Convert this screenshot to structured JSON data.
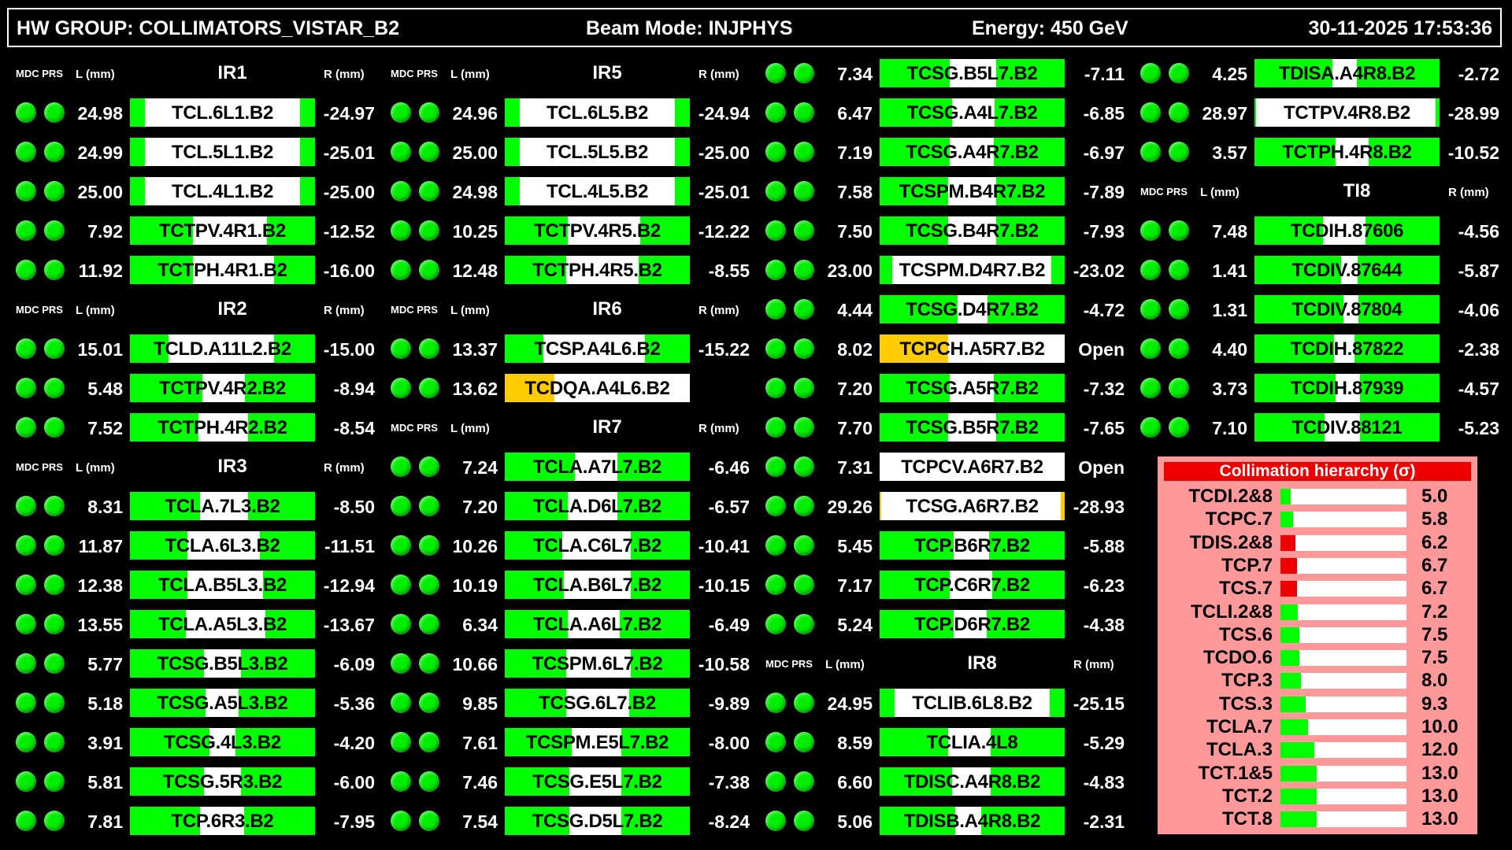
{
  "header": {
    "hw_group": "HW GROUP: COLLIMATORS_VISTAR_B2",
    "beam_mode": "Beam Mode: INJPHYS",
    "energy": "Energy: 450 GeV",
    "datetime": "30-11-2025 17:53:36"
  },
  "labels": {
    "mdc_prs": "MDC PRS",
    "l_mm": "L (mm)",
    "r_mm": "R (mm)"
  },
  "colors": {
    "green": "#00ff00",
    "orange": "#ffcc00",
    "white": "#ffffff",
    "led": "#00ee00",
    "red": "#ee0000",
    "pink": "#ff9999"
  },
  "columns": [
    [
      {
        "type": "header",
        "ir": "IR1"
      },
      {
        "type": "row",
        "l": "24.98",
        "name": "TCL.6L1.B2",
        "r": "-24.97",
        "left": 0.08,
        "right": 0.92,
        "color": "green"
      },
      {
        "type": "row",
        "l": "24.99",
        "name": "TCL.5L1.B2",
        "r": "-25.01",
        "left": 0.08,
        "right": 0.92,
        "color": "green"
      },
      {
        "type": "row",
        "l": "25.00",
        "name": "TCL.4L1.B2",
        "r": "-25.00",
        "left": 0.08,
        "right": 0.92,
        "color": "green"
      },
      {
        "type": "row",
        "l": "7.92",
        "name": "TCTPV.4R1.B2",
        "r": "-12.52",
        "left": 0.34,
        "right": 0.74,
        "color": "green"
      },
      {
        "type": "row",
        "l": "11.92",
        "name": "TCTPH.4R1.B2",
        "r": "-16.00",
        "left": 0.34,
        "right": 0.78,
        "color": "green"
      },
      {
        "type": "header",
        "ir": "IR2"
      },
      {
        "type": "row",
        "l": "15.01",
        "name": "TCLD.A11L2.B2",
        "r": "-15.00",
        "left": 0.21,
        "right": 0.78,
        "color": "green"
      },
      {
        "type": "row",
        "l": "5.48",
        "name": "TCTPV.4R2.B2",
        "r": "-8.94",
        "left": 0.39,
        "right": 0.62,
        "color": "green"
      },
      {
        "type": "row",
        "l": "7.52",
        "name": "TCTPH.4R2.B2",
        "r": "-8.54",
        "left": 0.37,
        "right": 0.64,
        "color": "green"
      },
      {
        "type": "header",
        "ir": "IR3"
      },
      {
        "type": "row",
        "l": "8.31",
        "name": "TCLA.7L3.B2",
        "r": "-8.50",
        "left": 0.38,
        "right": 0.64,
        "color": "green"
      },
      {
        "type": "row",
        "l": "11.87",
        "name": "TCLA.6L3.B2",
        "r": "-11.51",
        "left": 0.31,
        "right": 0.7,
        "color": "green"
      },
      {
        "type": "row",
        "l": "12.38",
        "name": "TCLA.B5L3.B2",
        "r": "-12.94",
        "left": 0.31,
        "right": 0.72,
        "color": "green"
      },
      {
        "type": "row",
        "l": "13.55",
        "name": "TCLA.A5L3.B2",
        "r": "-13.67",
        "left": 0.3,
        "right": 0.73,
        "color": "green"
      },
      {
        "type": "row",
        "l": "5.77",
        "name": "TCSG.B5L3.B2",
        "r": "-6.09",
        "left": 0.4,
        "right": 0.6,
        "color": "green"
      },
      {
        "type": "row",
        "l": "5.18",
        "name": "TCSG.A5L3.B2",
        "r": "-5.36",
        "left": 0.41,
        "right": 0.59,
        "color": "green"
      },
      {
        "type": "row",
        "l": "3.91",
        "name": "TCSG.4L3.B2",
        "r": "-4.20",
        "left": 0.43,
        "right": 0.57,
        "color": "green"
      },
      {
        "type": "row",
        "l": "5.81",
        "name": "TCSG.5R3.B2",
        "r": "-6.00",
        "left": 0.4,
        "right": 0.6,
        "color": "green"
      },
      {
        "type": "row",
        "l": "7.81",
        "name": "TCP.6R3.B2",
        "r": "-7.95",
        "left": 0.38,
        "right": 0.62,
        "color": "green"
      }
    ],
    [
      {
        "type": "header",
        "ir": "IR5"
      },
      {
        "type": "row",
        "l": "24.96",
        "name": "TCL.6L5.B2",
        "r": "-24.94",
        "left": 0.08,
        "right": 0.92,
        "color": "green"
      },
      {
        "type": "row",
        "l": "25.00",
        "name": "TCL.5L5.B2",
        "r": "-25.00",
        "left": 0.08,
        "right": 0.92,
        "color": "green"
      },
      {
        "type": "row",
        "l": "24.98",
        "name": "TCL.4L5.B2",
        "r": "-25.01",
        "left": 0.08,
        "right": 0.92,
        "color": "green"
      },
      {
        "type": "row",
        "l": "10.25",
        "name": "TCTPV.4R5.B2",
        "r": "-12.22",
        "left": 0.34,
        "right": 0.73,
        "color": "green"
      },
      {
        "type": "row",
        "l": "12.48",
        "name": "TCTPH.4R5.B2",
        "r": "-8.55",
        "left": 0.33,
        "right": 0.72,
        "color": "green"
      },
      {
        "type": "header",
        "ir": "IR6"
      },
      {
        "type": "row",
        "l": "13.37",
        "name": "TCSP.A4L6.B2",
        "r": "-15.22",
        "left": 0.21,
        "right": 0.76,
        "color": "green"
      },
      {
        "type": "row",
        "l": "13.62",
        "name": "TCDQA.A4L6.B2",
        "r": "",
        "left": 0.27,
        "right": 1.0,
        "color": "orange"
      },
      {
        "type": "header",
        "ir": "IR7"
      },
      {
        "type": "row",
        "l": "7.24",
        "name": "TCLA.A7L7.B2",
        "r": "-6.46",
        "left": 0.38,
        "right": 0.61,
        "color": "green"
      },
      {
        "type": "row",
        "l": "7.20",
        "name": "TCLA.D6L7.B2",
        "r": "-6.57",
        "left": 0.34,
        "right": 0.61,
        "color": "green"
      },
      {
        "type": "row",
        "l": "10.26",
        "name": "TCLA.C6L7.B2",
        "r": "-10.41",
        "left": 0.31,
        "right": 0.68,
        "color": "green"
      },
      {
        "type": "row",
        "l": "10.19",
        "name": "TCLA.B6L7.B2",
        "r": "-10.15",
        "left": 0.32,
        "right": 0.68,
        "color": "green"
      },
      {
        "type": "row",
        "l": "6.34",
        "name": "TCLA.A6L7.B2",
        "r": "-6.49",
        "left": 0.34,
        "right": 0.62,
        "color": "green"
      },
      {
        "type": "row",
        "l": "10.66",
        "name": "TCSPM.6L7.B2",
        "r": "-10.58",
        "left": 0.33,
        "right": 0.68,
        "color": "green"
      },
      {
        "type": "row",
        "l": "9.85",
        "name": "TCSG.6L7.B2",
        "r": "-9.89",
        "left": 0.33,
        "right": 0.67,
        "color": "green"
      },
      {
        "type": "row",
        "l": "7.61",
        "name": "TCSPM.E5L7.B2",
        "r": "-8.00",
        "left": 0.36,
        "right": 0.63,
        "color": "green"
      },
      {
        "type": "row",
        "l": "7.46",
        "name": "TCSG.E5L7.B2",
        "r": "-7.38",
        "left": 0.35,
        "right": 0.63,
        "color": "green"
      },
      {
        "type": "row",
        "l": "7.54",
        "name": "TCSG.D5L7.B2",
        "r": "-8.24",
        "left": 0.35,
        "right": 0.63,
        "color": "green"
      }
    ],
    [
      {
        "type": "row",
        "l": "7.34",
        "name": "TCSG.B5L7.B2",
        "r": "-7.11",
        "left": 0.38,
        "right": 0.63,
        "color": "green"
      },
      {
        "type": "row",
        "l": "6.47",
        "name": "TCSG.A4L7.B2",
        "r": "-6.85",
        "left": 0.39,
        "right": 0.62,
        "color": "green"
      },
      {
        "type": "row",
        "l": "7.19",
        "name": "TCSG.A4R7.B2",
        "r": "-6.97",
        "left": 0.38,
        "right": 0.62,
        "color": "green"
      },
      {
        "type": "row",
        "l": "7.58",
        "name": "TCSPM.B4R7.B2",
        "r": "-7.89",
        "left": 0.37,
        "right": 0.63,
        "color": "green"
      },
      {
        "type": "row",
        "l": "7.50",
        "name": "TCSG.B4R7.B2",
        "r": "-7.93",
        "left": 0.37,
        "right": 0.63,
        "color": "green"
      },
      {
        "type": "row",
        "l": "23.00",
        "name": "TCSPM.D4R7.B2",
        "r": "-23.02",
        "left": 0.07,
        "right": 0.93,
        "color": "green"
      },
      {
        "type": "row",
        "l": "4.44",
        "name": "TCSG.D4R7.B2",
        "r": "-4.72",
        "left": 0.42,
        "right": 0.58,
        "color": "green"
      },
      {
        "type": "row",
        "l": "8.02",
        "name": "TCPCH.A5R7.B2",
        "r": "Open",
        "left": 0.37,
        "right": 1.0,
        "color": "orange"
      },
      {
        "type": "row",
        "l": "7.20",
        "name": "TCSG.A5R7.B2",
        "r": "-7.32",
        "left": 0.38,
        "right": 0.62,
        "color": "green"
      },
      {
        "type": "row",
        "l": "7.70",
        "name": "TCSG.B5R7.B2",
        "r": "-7.65",
        "left": 0.37,
        "right": 0.63,
        "color": "green"
      },
      {
        "type": "row",
        "l": "7.31",
        "name": "TCPCV.A6R7.B2",
        "r": "Open",
        "left": 0.0,
        "right": 1.0,
        "color": "green"
      },
      {
        "type": "row",
        "l": "29.26",
        "name": "TCSG.A6R7.B2",
        "r": "-28.93",
        "left": 0.01,
        "right": 0.98,
        "color": "orange"
      },
      {
        "type": "row",
        "l": "5.45",
        "name": "TCP.B6R7.B2",
        "r": "-5.88",
        "left": 0.4,
        "right": 0.59,
        "color": "green"
      },
      {
        "type": "row",
        "l": "7.17",
        "name": "TCP.C6R7.B2",
        "r": "-6.23",
        "left": 0.38,
        "right": 0.61,
        "color": "green"
      },
      {
        "type": "row",
        "l": "5.24",
        "name": "TCP.D6R7.B2",
        "r": "-4.38",
        "left": 0.4,
        "right": 0.58,
        "color": "green"
      },
      {
        "type": "header",
        "ir": "IR8"
      },
      {
        "type": "row",
        "l": "24.95",
        "name": "TCLIB.6L8.B2",
        "r": "-25.15",
        "left": 0.08,
        "right": 0.92,
        "color": "green"
      },
      {
        "type": "row",
        "l": "8.59",
        "name": "TCLIA.4L8",
        "r": "-5.29",
        "left": 0.37,
        "right": 0.6,
        "color": "green"
      },
      {
        "type": "row",
        "l": "6.60",
        "name": "TDISC.A4R8.B2",
        "r": "-4.83",
        "left": 0.39,
        "right": 0.6,
        "color": "green"
      },
      {
        "type": "row",
        "l": "5.06",
        "name": "TDISB.A4R8.B2",
        "r": "-2.31",
        "left": 0.41,
        "right": 0.55,
        "color": "green"
      }
    ],
    [
      {
        "type": "row",
        "l": "4.25",
        "name": "TDISA.A4R8.B2",
        "r": "-2.72",
        "left": 0.42,
        "right": 0.55,
        "color": "green"
      },
      {
        "type": "row",
        "l": "28.97",
        "name": "TCTPV.4R8.B2",
        "r": "-28.99",
        "left": 0.01,
        "right": 0.98,
        "color": "green"
      },
      {
        "type": "row",
        "l": "3.57",
        "name": "TCTPH.4R8.B2",
        "r": "-10.52",
        "left": 0.44,
        "right": 0.62,
        "color": "green"
      },
      {
        "type": "header",
        "ir": "TI8"
      },
      {
        "type": "row",
        "l": "7.48",
        "name": "TCDIH.87606",
        "r": "-4.56",
        "left": 0.37,
        "right": 0.6,
        "color": "green"
      },
      {
        "type": "row",
        "l": "1.41",
        "name": "TCDIV.87644",
        "r": "-5.87",
        "left": 0.47,
        "right": 0.56,
        "color": "green"
      },
      {
        "type": "row",
        "l": "1.31",
        "name": "TCDIV.87804",
        "r": "-4.06",
        "left": 0.48,
        "right": 0.56,
        "color": "green"
      },
      {
        "type": "row",
        "l": "4.40",
        "name": "TCDIH.87822",
        "r": "-2.38",
        "left": 0.43,
        "right": 0.54,
        "color": "green"
      },
      {
        "type": "row",
        "l": "3.73",
        "name": "TCDIH.87939",
        "r": "-4.57",
        "left": 0.44,
        "right": 0.57,
        "color": "green"
      },
      {
        "type": "row",
        "l": "7.10",
        "name": "TCDIV.88121",
        "r": "-5.23",
        "left": 0.38,
        "right": 0.57,
        "color": "green"
      }
    ]
  ],
  "hierarchy": {
    "title": "Collimation hierarchy (σ)",
    "items": [
      {
        "name": "TCDI.2&8",
        "value": "5.0",
        "fill": 0.08,
        "color": "green"
      },
      {
        "name": "TCPC.7",
        "value": "5.8",
        "fill": 0.1,
        "color": "green"
      },
      {
        "name": "TDIS.2&8",
        "value": "6.2",
        "fill": 0.12,
        "color": "red"
      },
      {
        "name": "TCP.7",
        "value": "6.7",
        "fill": 0.13,
        "color": "red"
      },
      {
        "name": "TCS.7",
        "value": "6.7",
        "fill": 0.13,
        "color": "red"
      },
      {
        "name": "TCLI.2&8",
        "value": "7.2",
        "fill": 0.14,
        "color": "green"
      },
      {
        "name": "TCS.6",
        "value": "7.5",
        "fill": 0.15,
        "color": "green"
      },
      {
        "name": "TCDO.6",
        "value": "7.5",
        "fill": 0.15,
        "color": "green"
      },
      {
        "name": "TCP.3",
        "value": "8.0",
        "fill": 0.16,
        "color": "green"
      },
      {
        "name": "TCS.3",
        "value": "9.3",
        "fill": 0.2,
        "color": "green"
      },
      {
        "name": "TCLA.7",
        "value": "10.0",
        "fill": 0.22,
        "color": "green"
      },
      {
        "name": "TCLA.3",
        "value": "12.0",
        "fill": 0.27,
        "color": "green"
      },
      {
        "name": "TCT.1&5",
        "value": "13.0",
        "fill": 0.29,
        "color": "green"
      },
      {
        "name": "TCT.2",
        "value": "13.0",
        "fill": 0.29,
        "color": "green"
      },
      {
        "name": "TCT.8",
        "value": "13.0",
        "fill": 0.29,
        "color": "green"
      }
    ]
  }
}
